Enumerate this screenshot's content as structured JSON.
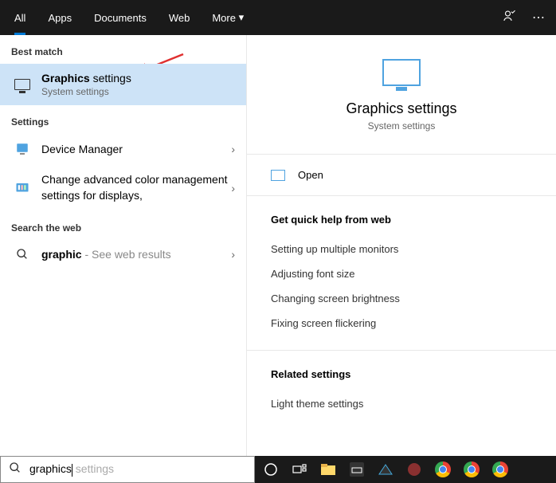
{
  "tabs": {
    "all": "All",
    "apps": "Apps",
    "documents": "Documents",
    "web": "Web",
    "more": "More"
  },
  "sections": {
    "bestMatch": "Best match",
    "settings": "Settings",
    "searchWeb": "Search the web"
  },
  "results": {
    "graphics": {
      "title_bold": "Graphics",
      "title_rest": " settings",
      "sub": "System settings"
    },
    "deviceManager": {
      "title": "Device Manager"
    },
    "colorMgmt": {
      "title": "Change advanced color management settings for displays,"
    },
    "webGraphic": {
      "title_bold": "graphic",
      "rest": " - See web results"
    }
  },
  "preview": {
    "title": "Graphics settings",
    "sub": "System settings",
    "open": "Open",
    "quickHelp": "Get quick help from web",
    "helpItems": [
      "Setting up multiple monitors",
      "Adjusting font size",
      "Changing screen brightness",
      "Fixing screen flickering"
    ],
    "related": "Related settings",
    "relatedItems": [
      "Light theme settings"
    ]
  },
  "search": {
    "typed": "graphics",
    "ghost": " settings"
  }
}
